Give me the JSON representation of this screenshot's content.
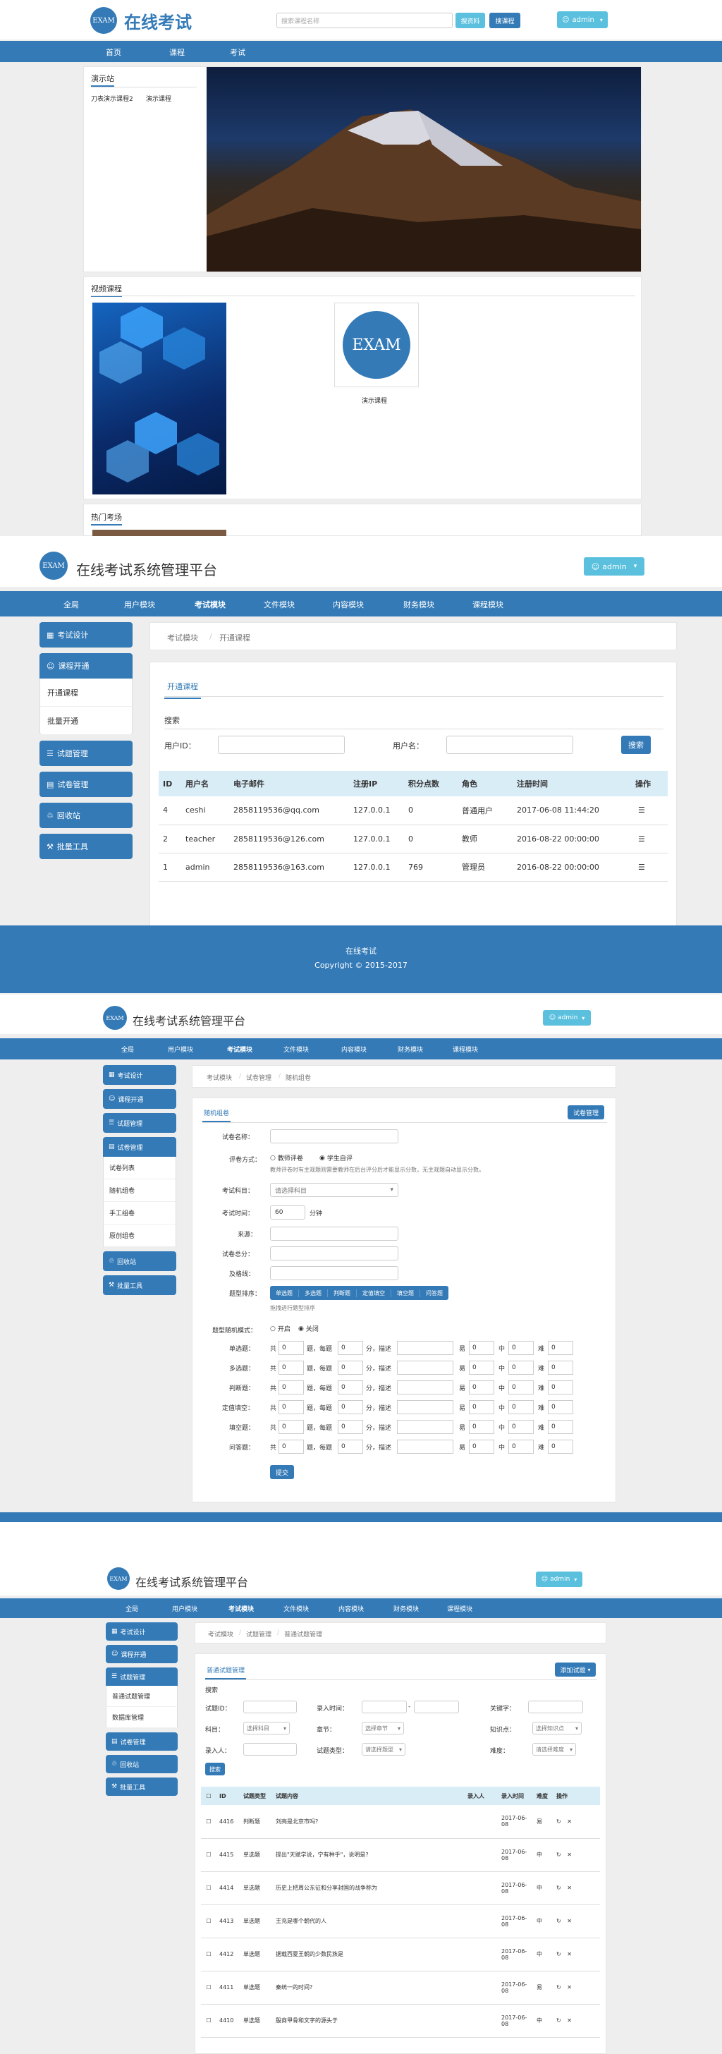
{
  "s1": {
    "brand": "在线考试",
    "logo_text": "EXAM",
    "search_placeholder": "搜索课程名称",
    "search_btn": "搜资料",
    "account_btn": "搜课程",
    "user_label": "admin",
    "nav": [
      "首页",
      "课程",
      "考试"
    ],
    "demo_title": "演示站",
    "demo_links": [
      "刀表演示课程2",
      "演示课程"
    ],
    "recommend_title": "视频课程",
    "course_name": "演示课程",
    "hot_title": "热门考场"
  },
  "admin": {
    "brand": "在线考试系统管理平台",
    "logo_text": "EXAM",
    "user_label": "admin",
    "nav": [
      "全局",
      "用户模块",
      "考试模块",
      "文件模块",
      "内容模块",
      "财务模块",
      "课程模块"
    ]
  },
  "s2": {
    "sidebar": {
      "exam_design": "考试设计",
      "course_open": "课程开通",
      "sub_open": "开通课程",
      "sub_batch": "批量开通",
      "question_mgmt": "试题管理",
      "paper_mgmt": "试卷管理",
      "recycle": "回收站",
      "batch_tools": "批量工具"
    },
    "breadcrumb": [
      "考试模块",
      "开通课程"
    ],
    "tab": "开通课程",
    "search_title": "搜索",
    "user_id_label": "用户ID：",
    "username_label": "用户名：",
    "search_btn": "搜索",
    "table": {
      "headers": [
        "ID",
        "用户名",
        "电子邮件",
        "注册IP",
        "积分点数",
        "角色",
        "注册时间",
        "操作"
      ],
      "rows": [
        [
          "4",
          "ceshi",
          "2858119536@qq.com",
          "127.0.0.1",
          "0",
          "普通用户",
          "2017-06-08 11:44:20"
        ],
        [
          "2",
          "teacher",
          "2858119536@126.com",
          "127.0.0.1",
          "0",
          "教师",
          "2016-08-22 00:00:00"
        ],
        [
          "1",
          "admin",
          "2858119536@163.com",
          "127.0.0.1",
          "769",
          "管理员",
          "2016-08-22 00:00:00"
        ]
      ]
    },
    "footer_line1": "在线考试",
    "footer_line2": "Copyright © 2015-2017"
  },
  "s3": {
    "sidebar_sub": [
      "试卷列表",
      "随机组卷",
      "手工组卷",
      "原创组卷"
    ],
    "breadcrumb": [
      "考试模块",
      "试卷管理",
      "随机组卷"
    ],
    "tab": "随机组卷",
    "paper_mgmt_btn": "试卷管理",
    "labels": {
      "name": "试卷名称：",
      "mode": "评卷方式：",
      "subject": "考试科目：",
      "duration": "考试时间：",
      "source": "来源：",
      "total": "试卷总分：",
      "pass": "及格线：",
      "order": "题型排序：",
      "random": "题型随机模式："
    },
    "mode_opts": [
      "教师评卷",
      "学生自评"
    ],
    "mode_hint": "教师评卷时有主观题则需要教师在后台评分后才能显示分数，无主观题自动显示分数。",
    "subject_placeholder": "请选择科目",
    "duration_value": "60",
    "duration_unit": "分钟",
    "order_types": [
      "单选题",
      "多选题",
      "判断题",
      "定值填空",
      "填空题",
      "问答题"
    ],
    "order_hint": "拖拽进行题型排序",
    "random_opts": [
      "开启",
      "关闭"
    ],
    "row_labels": [
      "单选题：",
      "多选题：",
      "判断题：",
      "定值填空：",
      "填空题：",
      "问答题："
    ],
    "row_words": [
      "共",
      "题，每题",
      "分，描述",
      "易",
      "中",
      "难"
    ],
    "zero": "0",
    "submit": "提交"
  },
  "s4": {
    "sidebar_sub": [
      "普通试题管理",
      "数据库管理"
    ],
    "breadcrumb": [
      "考试模块",
      "试题管理",
      "普通试题管理"
    ],
    "tab": "普通试题管理",
    "add_btn": "添加试题",
    "search_title": "搜索",
    "labels": {
      "qid": "试题ID：",
      "entry_time": "录入时间：",
      "keyword": "关键字：",
      "subject": "科目：",
      "chapter": "章节：",
      "knowledge": "知识点：",
      "entry_person": "录入人：",
      "qtype": "试题类型：",
      "difficulty": "难度："
    },
    "select_subject": "选择科目",
    "select_chapter": "选择章节",
    "select_knowledge": "选择知识点",
    "select_qtype": "请选择题型",
    "select_difficulty": "请选择难度",
    "search_btn": "搜索",
    "table_headers": [
      "ID",
      "试题类型",
      "试题内容",
      "录入人",
      "录入时间",
      "难度",
      "操作"
    ],
    "rows": [
      [
        "4416",
        "判断题",
        "刘亮是北京市吗?",
        "2017-06-08",
        "易"
      ],
      [
        "4415",
        "单选题",
        "提出\"天赋学说，宁有种乎\"，说明是?",
        "2017-06-08",
        "中"
      ],
      [
        "4414",
        "单选题",
        "历史上把周公东征和分享封国的战争称为",
        "2017-06-08",
        "中"
      ],
      [
        "4413",
        "单选题",
        "王充是哪个朝代的人",
        "2017-06-08",
        "中"
      ],
      [
        "4412",
        "单选题",
        "据载西夏王朝的少数民族是",
        "2017-06-08",
        "中"
      ],
      [
        "4411",
        "单选题",
        "秦统一的时间?",
        "2017-06-08",
        "易"
      ],
      [
        "4410",
        "单选题",
        "殷商甲骨和文字的源头于",
        "2017-06-08",
        "中"
      ]
    ]
  },
  "colors": {
    "primary": "#337ab7",
    "info": "#5bc0de",
    "grey": "#eeeeee"
  }
}
